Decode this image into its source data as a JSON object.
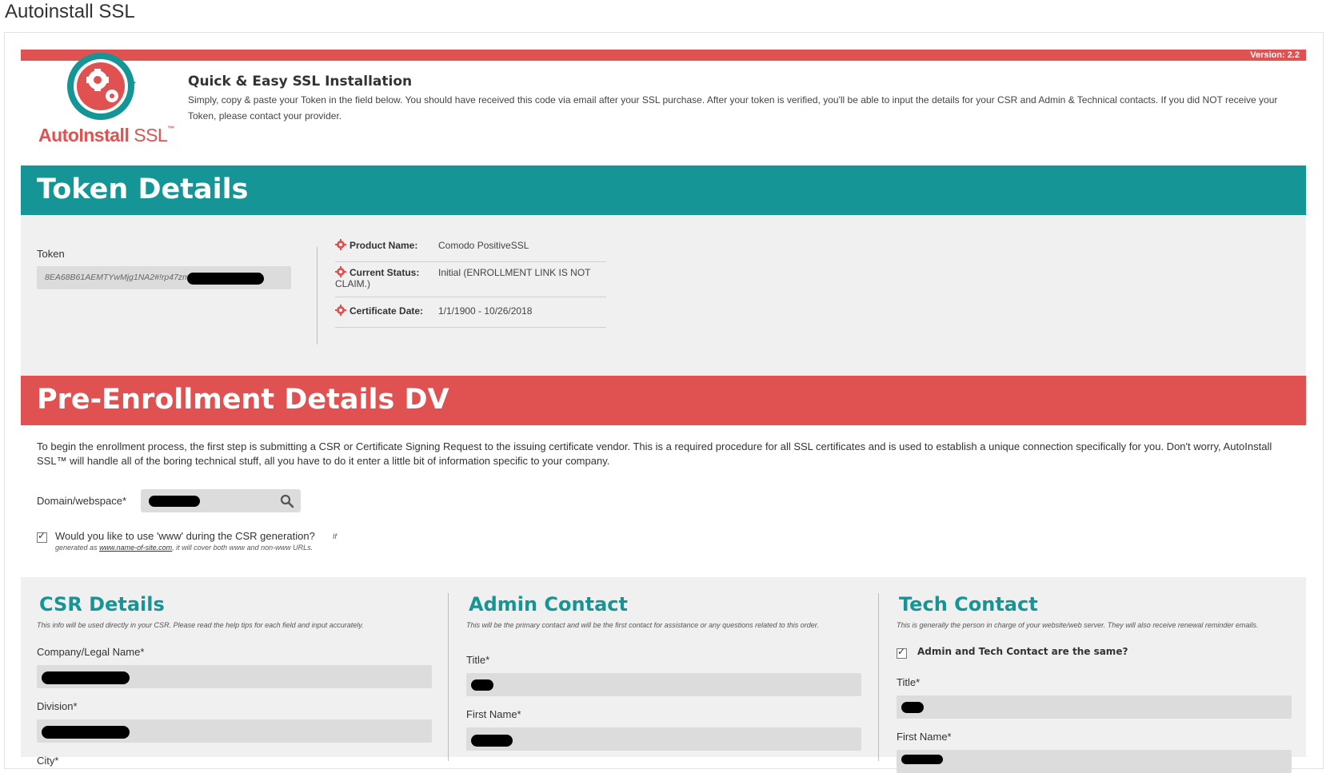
{
  "page": {
    "title": "Autoinstall SSL"
  },
  "header": {
    "version": "Version: 2.2",
    "logo_text_auto": "AutoInstall",
    "logo_text_ssl": "SSL",
    "logo_tm": "™",
    "title": "Quick & Easy SSL Installation",
    "description": "Simply, copy & paste your Token in the field below. You should have received this code via email after your SSL purchase. After your token is verified, you'll be able to input the details for your CSR and Admin & Technical contacts. If you did NOT receive your Token, please contact your provider."
  },
  "token_section": {
    "heading": "Token Details",
    "token_label": "Token",
    "token_value": "8EA68B61AEMTYwMjg1NA2#!rp47zm",
    "info": [
      {
        "label": "Product Name:",
        "value": "Comodo PositiveSSL"
      },
      {
        "label": "Current Status:",
        "value": "Initial (ENROLLMENT LINK IS NOT",
        "value2": "CLAIM.)"
      },
      {
        "label": "Certificate Date:",
        "value": "1/1/1900 - 10/26/2018"
      }
    ],
    "icon": "gear-icon"
  },
  "pre_enrollment": {
    "heading": "Pre-Enrollment Details DV",
    "description": "To begin the enrollment process, the first step is submitting a CSR or Certificate Signing Request to the issuing certificate vendor. This is a required procedure for all SSL certificates and is used to establish a unique connection specifically for you. Don't worry, AutoInstall SSL™ will handle all of the boring technical stuff, all you have to do it enter a little bit of information specific to your company.",
    "domain_label": "Domain/webspace*",
    "www_question": "Would you like to use 'www' during the CSR generation?",
    "www_note_start": "If",
    "www_note_generated": "generated as",
    "www_note_link": "www.name-of-site.com",
    "www_note_end": ", it will cover both www and non-www URLs.",
    "www_checked": true
  },
  "csr": {
    "heading": "CSR Details",
    "subtitle": "This info will be used directly in your CSR. Please read the help tips for each field and input accurately.",
    "fields": [
      "Company/Legal Name*",
      "Division*",
      "City*"
    ]
  },
  "admin": {
    "heading": "Admin Contact",
    "subtitle": "This will be the primary contact and will be the first contact for assistance or any questions related to this order.",
    "fields": [
      "Title*",
      "First Name*"
    ]
  },
  "tech": {
    "heading": "Tech Contact",
    "subtitle": "This is generally the person in charge of your website/web server. They will also receive renewal reminder emails.",
    "same_label": "Admin and Tech Contact are the same?",
    "same_checked": true,
    "fields": [
      "Title*",
      "First Name*"
    ]
  },
  "colors": {
    "teal": "#159596",
    "red": "#e05252",
    "panel_bg": "#f0f0f0",
    "input_bg": "#dcdcdc"
  }
}
